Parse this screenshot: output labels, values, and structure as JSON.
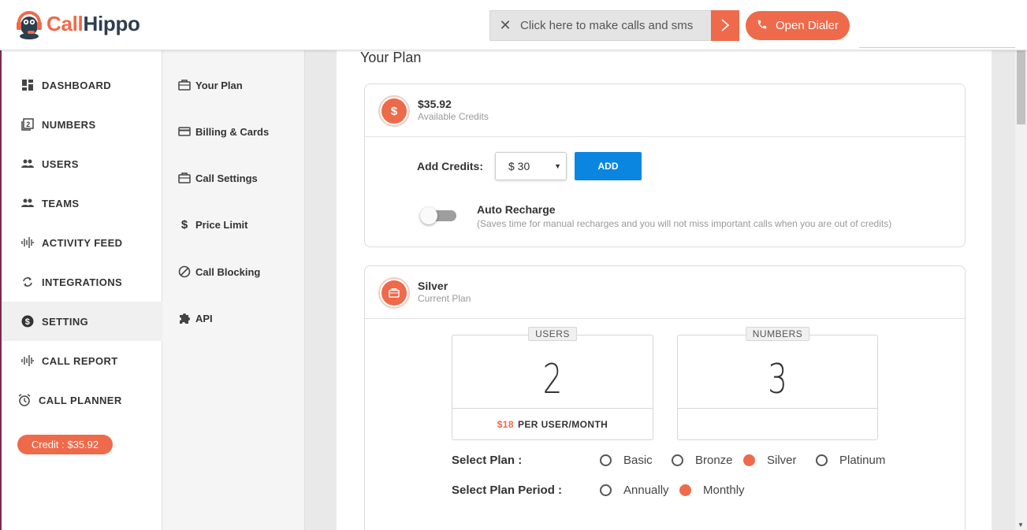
{
  "header": {
    "logo_part1": "Call",
    "logo_part2": "Hippo",
    "call_bar_text": "Click here to make calls and sms",
    "dialer_label": "Open Dialer"
  },
  "sidebar": {
    "items": [
      {
        "label": "DASHBOARD",
        "icon": "dashboard-icon"
      },
      {
        "label": "NUMBERS",
        "icon": "numbers-icon"
      },
      {
        "label": "USERS",
        "icon": "users-icon"
      },
      {
        "label": "TEAMS",
        "icon": "teams-icon"
      },
      {
        "label": "ACTIVITY FEED",
        "icon": "activity-icon"
      },
      {
        "label": "INTEGRATIONS",
        "icon": "sync-icon"
      },
      {
        "label": "SETTING",
        "icon": "dollar-icon"
      },
      {
        "label": "CALL REPORT",
        "icon": "report-icon"
      },
      {
        "label": "CALL PLANNER",
        "icon": "alarm-icon"
      }
    ],
    "active": "SETTING",
    "credit_pill": "Credit : $35.92"
  },
  "subnav": {
    "items": [
      {
        "label": "Your Plan",
        "icon": "briefcase-icon"
      },
      {
        "label": "Billing & Cards",
        "icon": "card-icon"
      },
      {
        "label": "Call Settings",
        "icon": "briefcase-icon"
      },
      {
        "label": "Price Limit",
        "icon": "dollar-icon"
      },
      {
        "label": "Call Blocking",
        "icon": "block-icon"
      },
      {
        "label": "API",
        "icon": "puzzle-icon"
      }
    ]
  },
  "main": {
    "title": "Your Plan",
    "credits_panel": {
      "amount": "$35.92",
      "subtitle": "Available Credits",
      "icon_symbol": "$",
      "add_label": "Add Credits:",
      "selected_amount": "$ 30",
      "add_button": "ADD",
      "auto_recharge_title": "Auto Recharge",
      "auto_recharge_desc": "(Saves time for manual recharges and you will not miss important calls when you are out of credits)",
      "auto_recharge_on": false
    },
    "plan_panel": {
      "plan_name": "Silver",
      "subtitle": "Current Plan",
      "users_label": "USERS",
      "users_value": "2",
      "users_price": "$18",
      "users_price_suffix": "PER USER/MONTH",
      "numbers_label": "NUMBERS",
      "numbers_value": "3",
      "select_plan_label": "Select Plan :",
      "plans": [
        "Basic",
        "Bronze",
        "Silver",
        "Platinum"
      ],
      "selected_plan": "Silver",
      "select_period_label": "Select Plan Period :",
      "periods": [
        "Annually",
        "Monthly"
      ],
      "selected_period": "Monthly"
    }
  },
  "colors": {
    "brand_orange": "#ee6a4a",
    "brand_dark": "#2d3e4e",
    "add_blue": "#0a86e0"
  }
}
